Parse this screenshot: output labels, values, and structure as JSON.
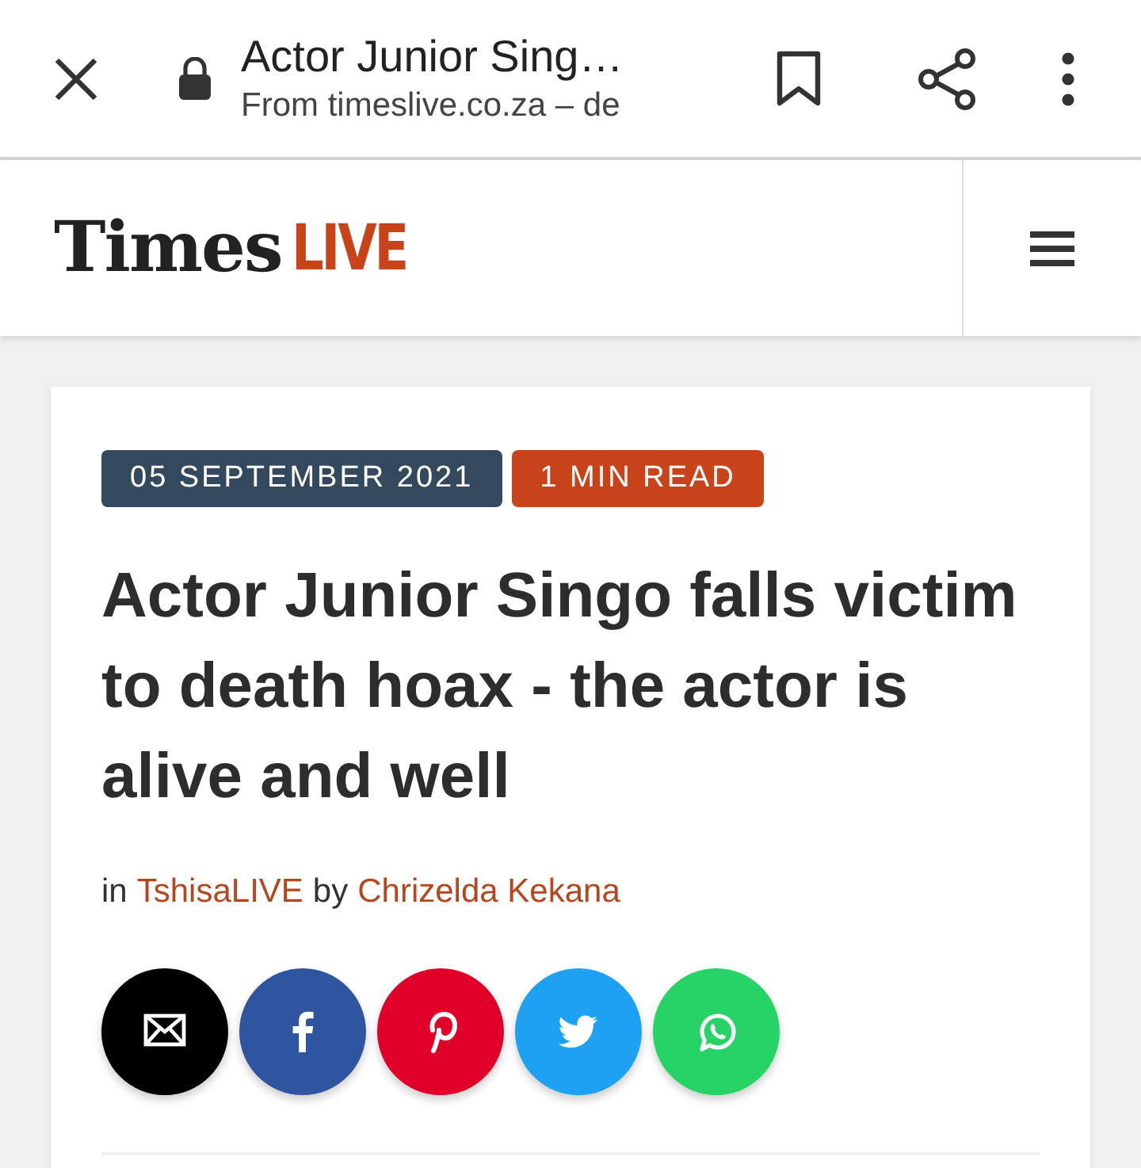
{
  "browser_bar": {
    "title": "Actor Junior Sing…",
    "url": "From timeslive.co.za – de"
  },
  "site_header": {
    "logo_text": "Times",
    "logo_accent": "LIVE"
  },
  "article": {
    "date": "05 SEPTEMBER 2021",
    "read_time": "1 MIN READ",
    "headline": "Actor Junior Singo falls victim to death hoax - the actor is alive and well",
    "byline": {
      "prefix": "in",
      "section": "TshisaLIVE",
      "joiner": "by",
      "author": "Chrizelda Kekana"
    }
  },
  "share_buttons": [
    {
      "kind": "email",
      "color": "#000000"
    },
    {
      "kind": "facebook",
      "color": "#2f54a0"
    },
    {
      "kind": "pinterest",
      "color": "#e0002a"
    },
    {
      "kind": "twitter",
      "color": "#1da1f2"
    },
    {
      "kind": "whatsapp",
      "color": "#25d366"
    }
  ]
}
